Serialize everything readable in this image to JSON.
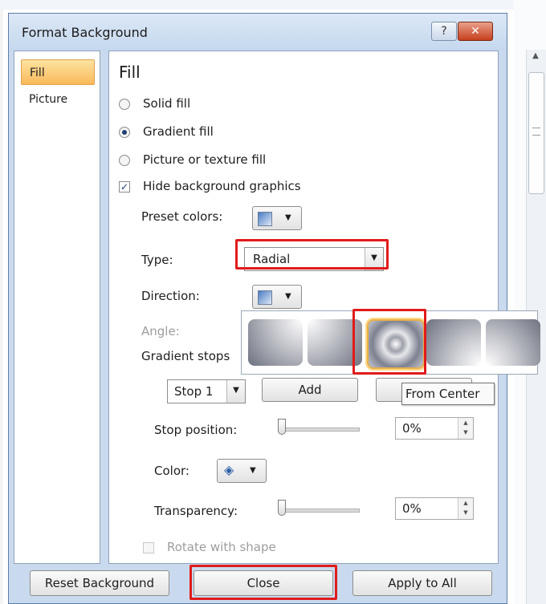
{
  "dialog": {
    "title": "Format Background",
    "help_label": "?",
    "close_glyph": "✕"
  },
  "nav": {
    "items": [
      {
        "label": "Fill"
      },
      {
        "label": "Picture"
      }
    ]
  },
  "fill": {
    "heading": "Fill",
    "options": [
      {
        "label": "Solid fill",
        "selected": false
      },
      {
        "label": "Gradient fill",
        "selected": true
      },
      {
        "label": "Picture or texture fill",
        "selected": false
      }
    ],
    "hide_graphics_label": "Hide background graphics",
    "hide_graphics_checked": true,
    "preset_colors_label": "Preset colors:",
    "type_label": "Type:",
    "type_value": "Radial",
    "direction_label": "Direction:",
    "angle_label": "Angle:",
    "gradient_stops_label": "Gradient stops",
    "stop_value": "Stop 1",
    "add_label": "Add",
    "stop_position_label": "Stop position:",
    "stop_position_value": "0%",
    "color_label": "Color:",
    "transparency_label": "Transparency:",
    "transparency_value": "0%",
    "rotate_label": "Rotate with shape"
  },
  "gallery": {
    "tooltip": "From Center",
    "selected_index": 2,
    "tiles": 5
  },
  "footer": {
    "reset_label": "Reset Background",
    "close_label": "Close",
    "apply_label": "Apply to All"
  },
  "colors": {
    "highlight": "#e01b1b",
    "selection": "#f9b95a"
  }
}
